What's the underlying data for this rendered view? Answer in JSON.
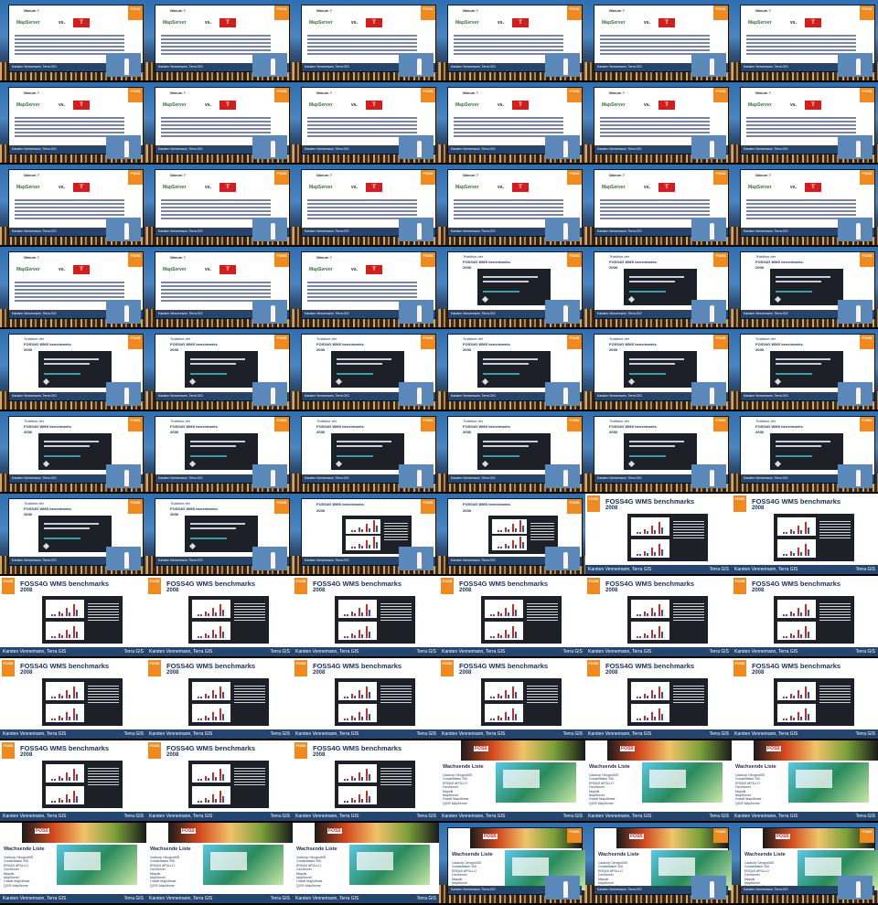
{
  "slides": {
    "warum": {
      "title": "Warum ?",
      "mapserver": "MapServer",
      "vs": "vs.",
      "t": "T",
      "footer_left": "Karsten Vennemann, Terra GIS",
      "footer_right": "Terra GIS"
    },
    "tradition": {
      "italic": "Tradition der",
      "title": "FOSS4G WMS benchmarks",
      "year": "2008",
      "footer_left": "Karsten Vennemann, Terra GIS",
      "footer_right": "Terra GIS"
    },
    "benchmarks": {
      "title": "FOSS4G WMS benchmarks",
      "year": "2008",
      "footer_left": "Karsten Vennemann, Terra GIS",
      "footer_right": "Terra GIS"
    },
    "liste": {
      "title": "Wachsende Liste",
      "items": [
        "Cadcorp GeognoSIS",
        "Constellation SDI",
        "ERDAS APOLLO",
        "GeoServer",
        "Mapnik",
        "MapServer",
        "Oracle MapViewer",
        "QGIS MapServer"
      ],
      "footer_left": "Karsten Vennemann, Terra GIS",
      "footer_right": "Terra GIS"
    },
    "logo": "FOSS"
  },
  "grid": {
    "rows": 11,
    "cols": 6,
    "sequence": [
      "warum",
      "warum",
      "warum",
      "warum",
      "warum",
      "warum",
      "warum",
      "warum",
      "warum",
      "warum",
      "warum",
      "warum",
      "warum",
      "warum",
      "warum",
      "warum",
      "warum",
      "warum",
      "warum",
      "warum",
      "warum",
      "tradition",
      "tradition",
      "tradition",
      "tradition",
      "tradition",
      "tradition",
      "tradition",
      "tradition",
      "tradition",
      "tradition",
      "tradition",
      "tradition",
      "tradition",
      "tradition",
      "tradition",
      "tradition",
      "tradition",
      "results-stage",
      "results-stage",
      "benchmarks",
      "benchmarks",
      "benchmarks",
      "benchmarks",
      "benchmarks",
      "benchmarks",
      "benchmarks",
      "benchmarks",
      "benchmarks",
      "benchmarks",
      "benchmarks",
      "benchmarks",
      "benchmarks",
      "benchmarks",
      "benchmarks",
      "benchmarks",
      "benchmarks",
      "liste",
      "liste",
      "liste",
      "liste",
      "liste",
      "liste",
      "liste-stage",
      "liste-stage",
      "liste-stage"
    ]
  }
}
